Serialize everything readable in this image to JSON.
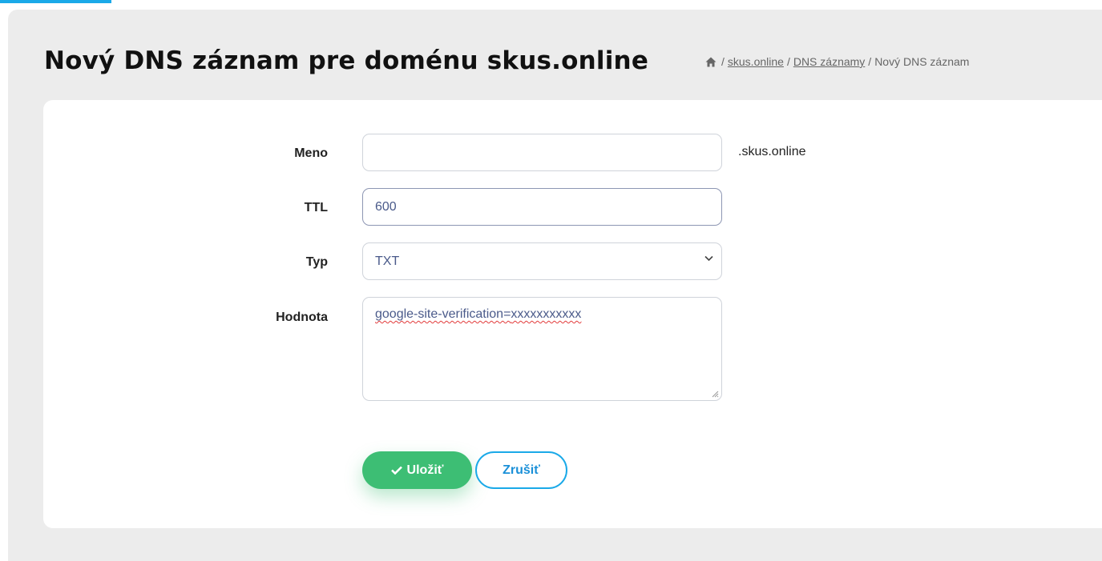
{
  "header": {
    "title": "Nový DNS záznam pre doménu skus.online",
    "breadcrumb": {
      "home_icon": "home-icon",
      "separator": "/",
      "items": [
        "skus.online",
        "DNS záznamy"
      ],
      "current": "Nový DNS záznam"
    }
  },
  "form": {
    "name": {
      "label": "Meno",
      "value": "",
      "suffix": ".skus.online"
    },
    "ttl": {
      "label": "TTL",
      "value": "600"
    },
    "type": {
      "label": "Typ",
      "selected": "TXT"
    },
    "value": {
      "label": "Hodnota",
      "text_part1": "google-site-verification=",
      "text_part2": "xxxxxxxxxxx"
    }
  },
  "actions": {
    "save_label": "Uložiť",
    "save_icon": "check-icon",
    "cancel_label": "Zrušiť"
  },
  "colors": {
    "accent": "#1aa9e8",
    "save_green": "#3dbe74",
    "page_bg": "#ececec"
  }
}
